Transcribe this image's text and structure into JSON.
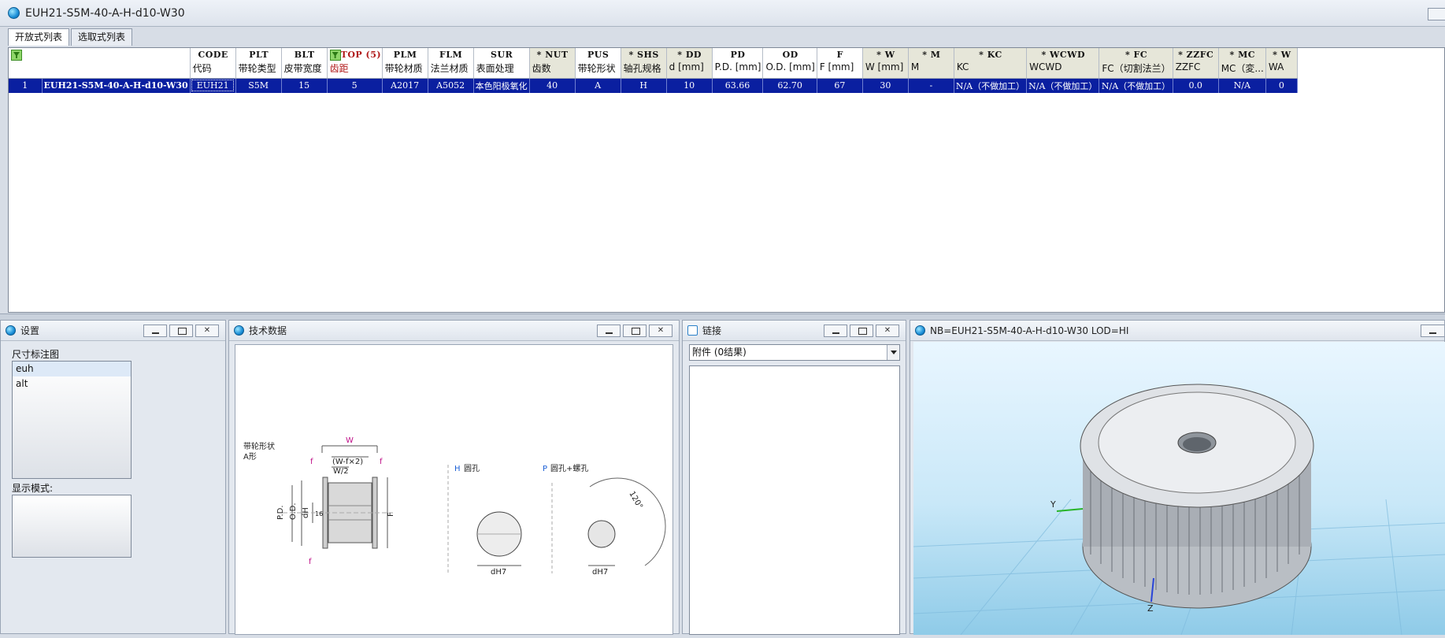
{
  "window": {
    "title": "EUH21-S5M-40-A-H-d10-W30"
  },
  "tabs": [
    {
      "label": "开放式列表"
    },
    {
      "label": "选取式列表"
    }
  ],
  "table": {
    "columns": [
      {
        "code": "",
        "caption": ""
      },
      {
        "code": "CODE",
        "caption": "代码"
      },
      {
        "code": "PLT",
        "caption": "带轮类型"
      },
      {
        "code": "BLT",
        "caption": "皮带宽度"
      },
      {
        "code": "TOP (5)",
        "caption": "齿距"
      },
      {
        "code": "PLM",
        "caption": "带轮材质"
      },
      {
        "code": "FLM",
        "caption": "法兰材质"
      },
      {
        "code": "SUR",
        "caption": "表面处理"
      },
      {
        "code": "* NUT",
        "caption": "齿数"
      },
      {
        "code": "PUS",
        "caption": "带轮形状"
      },
      {
        "code": "* SHS",
        "caption": "轴孔规格"
      },
      {
        "code": "* DD",
        "caption": "d [mm]"
      },
      {
        "code": "PD",
        "caption": "P.D. [mm]"
      },
      {
        "code": "OD",
        "caption": "O.D. [mm]"
      },
      {
        "code": "F",
        "caption": "F [mm]"
      },
      {
        "code": "* W",
        "caption": "W [mm]"
      },
      {
        "code": "* M",
        "caption": "M"
      },
      {
        "code": "* KC",
        "caption": "KC"
      },
      {
        "code": "* WCWD",
        "caption": "WCWD"
      },
      {
        "code": "* FC",
        "caption": "FC（切割法兰）"
      },
      {
        "code": "* ZZFC",
        "caption": "ZZFC"
      },
      {
        "code": "* MC",
        "caption": "MC（変..."
      },
      {
        "code": "* W",
        "caption": "WA"
      }
    ],
    "row": [
      "1",
      "EUH21-S5M-40-A-H-d10-W30",
      "EUH21",
      "S5M",
      "15",
      "5",
      "A2017",
      "A5052",
      "本色阳极氧化",
      "40",
      "A",
      "H",
      "10",
      "63.66",
      "62.70",
      "67",
      "30",
      "-",
      "N/A（不做加工）",
      "N/A（不做加工）",
      "N/A（不做加工）",
      "0.0",
      "N/A",
      "0"
    ]
  },
  "settings_panel": {
    "title": "设置",
    "dim_label": "尺寸标注图",
    "dim_items": [
      "euh",
      "alt"
    ],
    "display_label": "显示模式:"
  },
  "tech_panel": {
    "title": "技术数据",
    "drawing": {
      "shape_label": "带轮形状",
      "shape_type": "A形",
      "shape_letter": "A",
      "w": "W",
      "wf": "(W-f×2)",
      "w2": "W/2",
      "f": "f",
      "pd": "P.D.",
      "od": "O.D.",
      "dh": "dH",
      "sixteen": "16",
      "F": "F",
      "h_label": "H",
      "h_text": "圆孔",
      "p_label": "P",
      "p_text": "圆孔+螺孔",
      "angle": "120°",
      "dh7": "dH7"
    }
  },
  "link_panel": {
    "title": "链接",
    "combo_value": "附件 (0结果)"
  },
  "viewer_panel": {
    "title": "NB=EUH21-S5M-40-A-H-d10-W30 LOD=HI",
    "axis_y": "Y",
    "axis_z": "Z"
  }
}
